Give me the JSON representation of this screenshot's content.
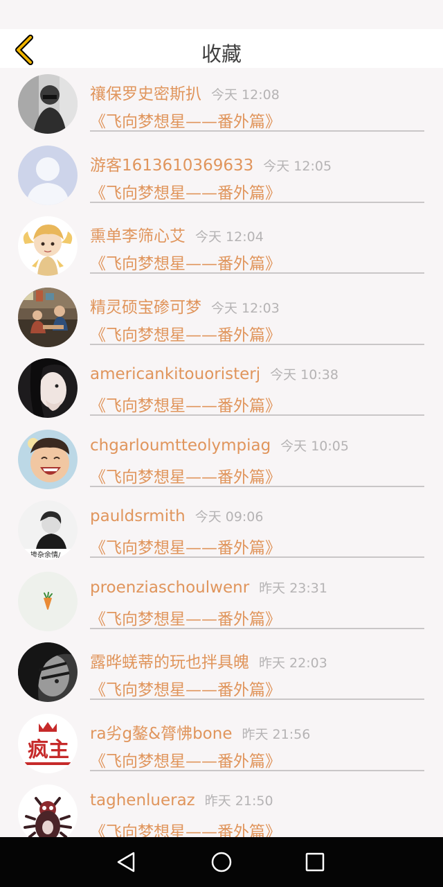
{
  "header": {
    "title": "收藏"
  },
  "colors": {
    "accent": "#e0955c",
    "time": "#b5b3b4",
    "back": "#f0b400"
  },
  "items": [
    {
      "username": "禳保罗史密斯扒",
      "time": "今天 12:08",
      "title": "《飞向梦想星——番外篇》",
      "avatar": "photo-grey"
    },
    {
      "username": "游客1613610369633",
      "time": "今天 12:05",
      "title": "《飞向梦想星——番外篇》",
      "avatar": "default-user"
    },
    {
      "username": "熏单李筛心艾",
      "time": "今天 12:04",
      "title": "《飞向梦想星——番外篇》",
      "avatar": "cartoon"
    },
    {
      "username": "精灵硕宝碜可梦",
      "time": "今天 12:03",
      "title": "《飞向梦想星——番外篇》",
      "avatar": "room"
    },
    {
      "username": "americankitouoristerj",
      "time": "今天 10:38",
      "title": "《飞向梦想星——番外篇》",
      "avatar": "girl"
    },
    {
      "username": "chgarloumtteolympiag",
      "time": "今天 10:05",
      "title": "《飞向梦想星——番外篇》",
      "avatar": "baby"
    },
    {
      "username": "pauldsrmith",
      "time": "今天 09:06",
      "title": "《飞向梦想星——番外篇》",
      "avatar": "man",
      "avatar_caption": "掺杂余情/"
    },
    {
      "username": "proenziaschoulwenr",
      "time": "昨天 23:31",
      "title": "《飞向梦想星——番外篇》",
      "avatar": "carrot"
    },
    {
      "username": "露晔蜣蒂的玩也拌具魄",
      "time": "昨天 22:03",
      "title": "《飞向梦想星——番外篇》",
      "avatar": "bw-face"
    },
    {
      "username": "ra劣g鏊&膂怫bone",
      "time": "昨天 21:56",
      "title": "《飞向梦想星——番外篇》",
      "avatar": "text-logo",
      "avatar_caption": "疯主"
    },
    {
      "username": "taghenlueraz",
      "time": "昨天 21:50",
      "title": "《飞向梦想星——番外篇》",
      "avatar": "bug"
    }
  ]
}
